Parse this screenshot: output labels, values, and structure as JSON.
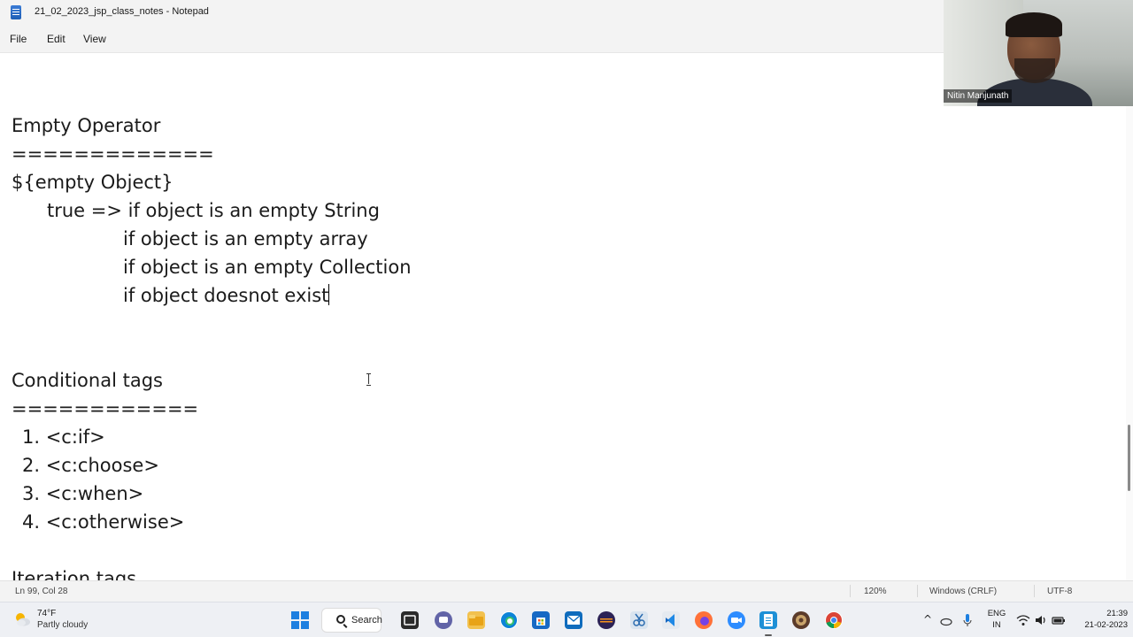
{
  "window": {
    "title": "21_02_2023_jsp_class_notes - Notepad"
  },
  "menu": {
    "file": "File",
    "edit": "Edit",
    "view": "View"
  },
  "editor": {
    "lines": [
      "Empty Operator",
      "=============",
      "${empty Object}",
      "true => if object is an empty String",
      "if object is an empty array",
      "if object is an empty Collection",
      "if object doesnot exist",
      "Conditional tags",
      "============",
      "1. <c:if>",
      "2. <c:choose>",
      "3. <c:when>",
      "4. <c:otherwise>",
      "Iteration tags"
    ]
  },
  "status": {
    "position": "Ln 99, Col 28",
    "zoom": "120%",
    "line_ending": "Windows (CRLF)",
    "encoding": "UTF-8"
  },
  "webcam": {
    "participant_name": "Nitin Manjunath"
  },
  "taskbar": {
    "weather_temp": "74°F",
    "weather_desc": "Partly cloudy",
    "search_label": "Search",
    "lang_primary": "ENG",
    "lang_secondary": "IN",
    "time": "21:39",
    "date": "21-02-2023"
  },
  "colors": {
    "accent": "#1d7fe0",
    "text": "#1b1b1b",
    "chrome": "#f3f3f3"
  },
  "icons": {
    "taskbar_apps": [
      "start-icon",
      "search-icon",
      "taskview-icon",
      "teams-chat-icon",
      "file-explorer-icon",
      "edge-icon",
      "store-icon",
      "mail-icon",
      "eclipse-icon",
      "snip-icon",
      "vscode-icon",
      "firefox-icon",
      "zoom-icon",
      "notepad-icon",
      "app-icon",
      "chrome-icon"
    ]
  }
}
